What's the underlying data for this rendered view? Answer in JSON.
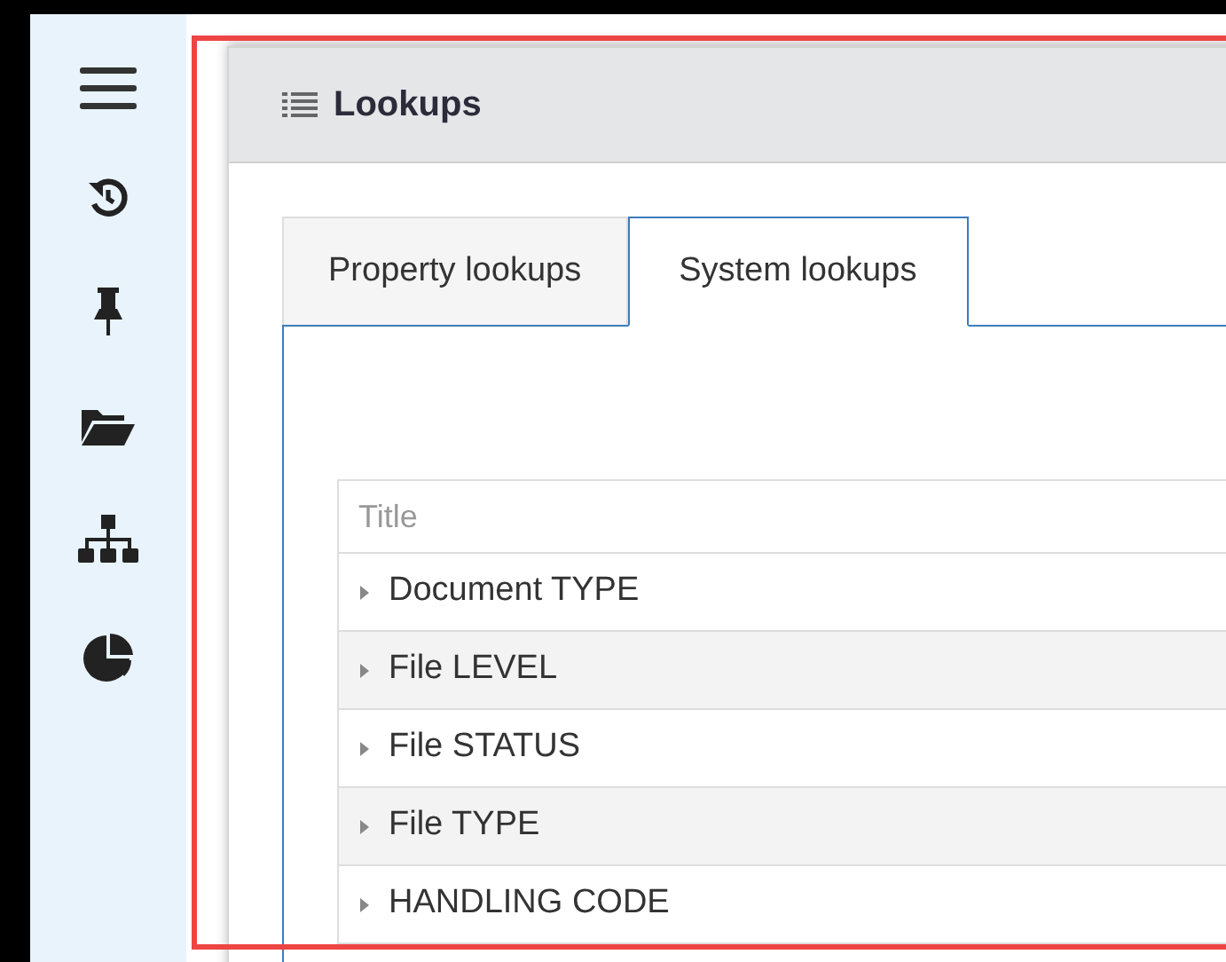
{
  "panel": {
    "title": "Lookups"
  },
  "tabs": [
    {
      "label": "Property lookups",
      "selected": false
    },
    {
      "label": "System lookups",
      "selected": true
    }
  ],
  "table": {
    "filter_placeholder": "Title",
    "rows": [
      {
        "title": "Document TYPE",
        "expanded": false
      },
      {
        "title": "File LEVEL",
        "expanded": false
      },
      {
        "title": "File STATUS",
        "expanded": false
      },
      {
        "title": "File TYPE",
        "expanded": false
      },
      {
        "title": "HANDLING CODE",
        "expanded": false
      }
    ]
  }
}
